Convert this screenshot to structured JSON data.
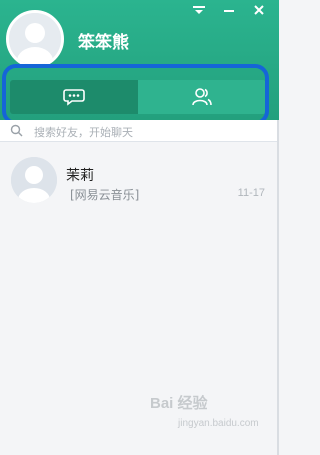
{
  "header": {
    "username": "笨笨熊",
    "window_controls": [
      "menu-icon",
      "minimize-icon",
      "close-icon"
    ],
    "accent": "#2bb48f"
  },
  "tabs": [
    {
      "name": "chat",
      "icon": "chat-bubble-icon",
      "active": true
    },
    {
      "name": "contacts",
      "icon": "contacts-icon",
      "active": false
    }
  ],
  "search": {
    "placeholder": "搜索好友，开始聊天"
  },
  "conversations": [
    {
      "name": "茉莉",
      "last_message": "[网易云音乐]",
      "time": "11-17"
    }
  ],
  "watermark": {
    "brand": "Bai 经验",
    "sub": "jingyan.baidu.com"
  }
}
